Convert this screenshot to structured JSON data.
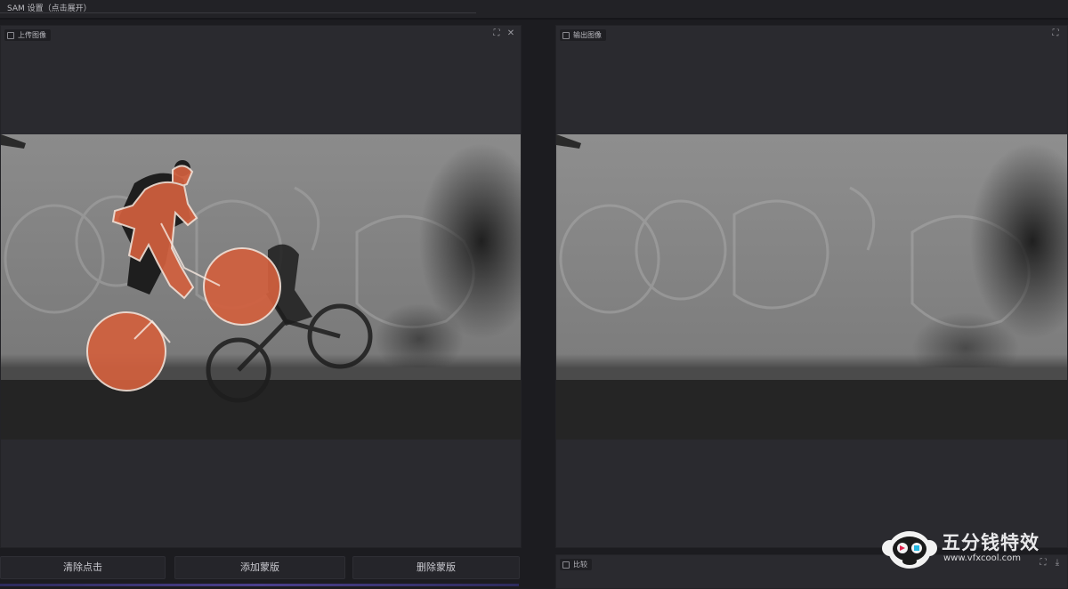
{
  "app": {
    "title": "SAM 设置（点击展开）"
  },
  "left_panel": {
    "label": "上传图像",
    "expand_icon": "expand-icon",
    "close_icon": "close-icon"
  },
  "right_panel": {
    "label": "输出图像",
    "expand_icon": "expand-icon"
  },
  "compare_panel": {
    "label": "比较"
  },
  "actions": {
    "clear_label": "清除点击",
    "add_label": "添加蒙版",
    "delete_label": "删除蒙版"
  },
  "watermark": {
    "name": "五分钱特效",
    "url": "www.vfxcool.com"
  },
  "colors": {
    "mask": "#d2603e",
    "mask_outline": "#f2ddd2",
    "panel_bg": "#2a2a2f",
    "app_bg": "#1c1c20",
    "accent_line": "#4a3f8c"
  }
}
